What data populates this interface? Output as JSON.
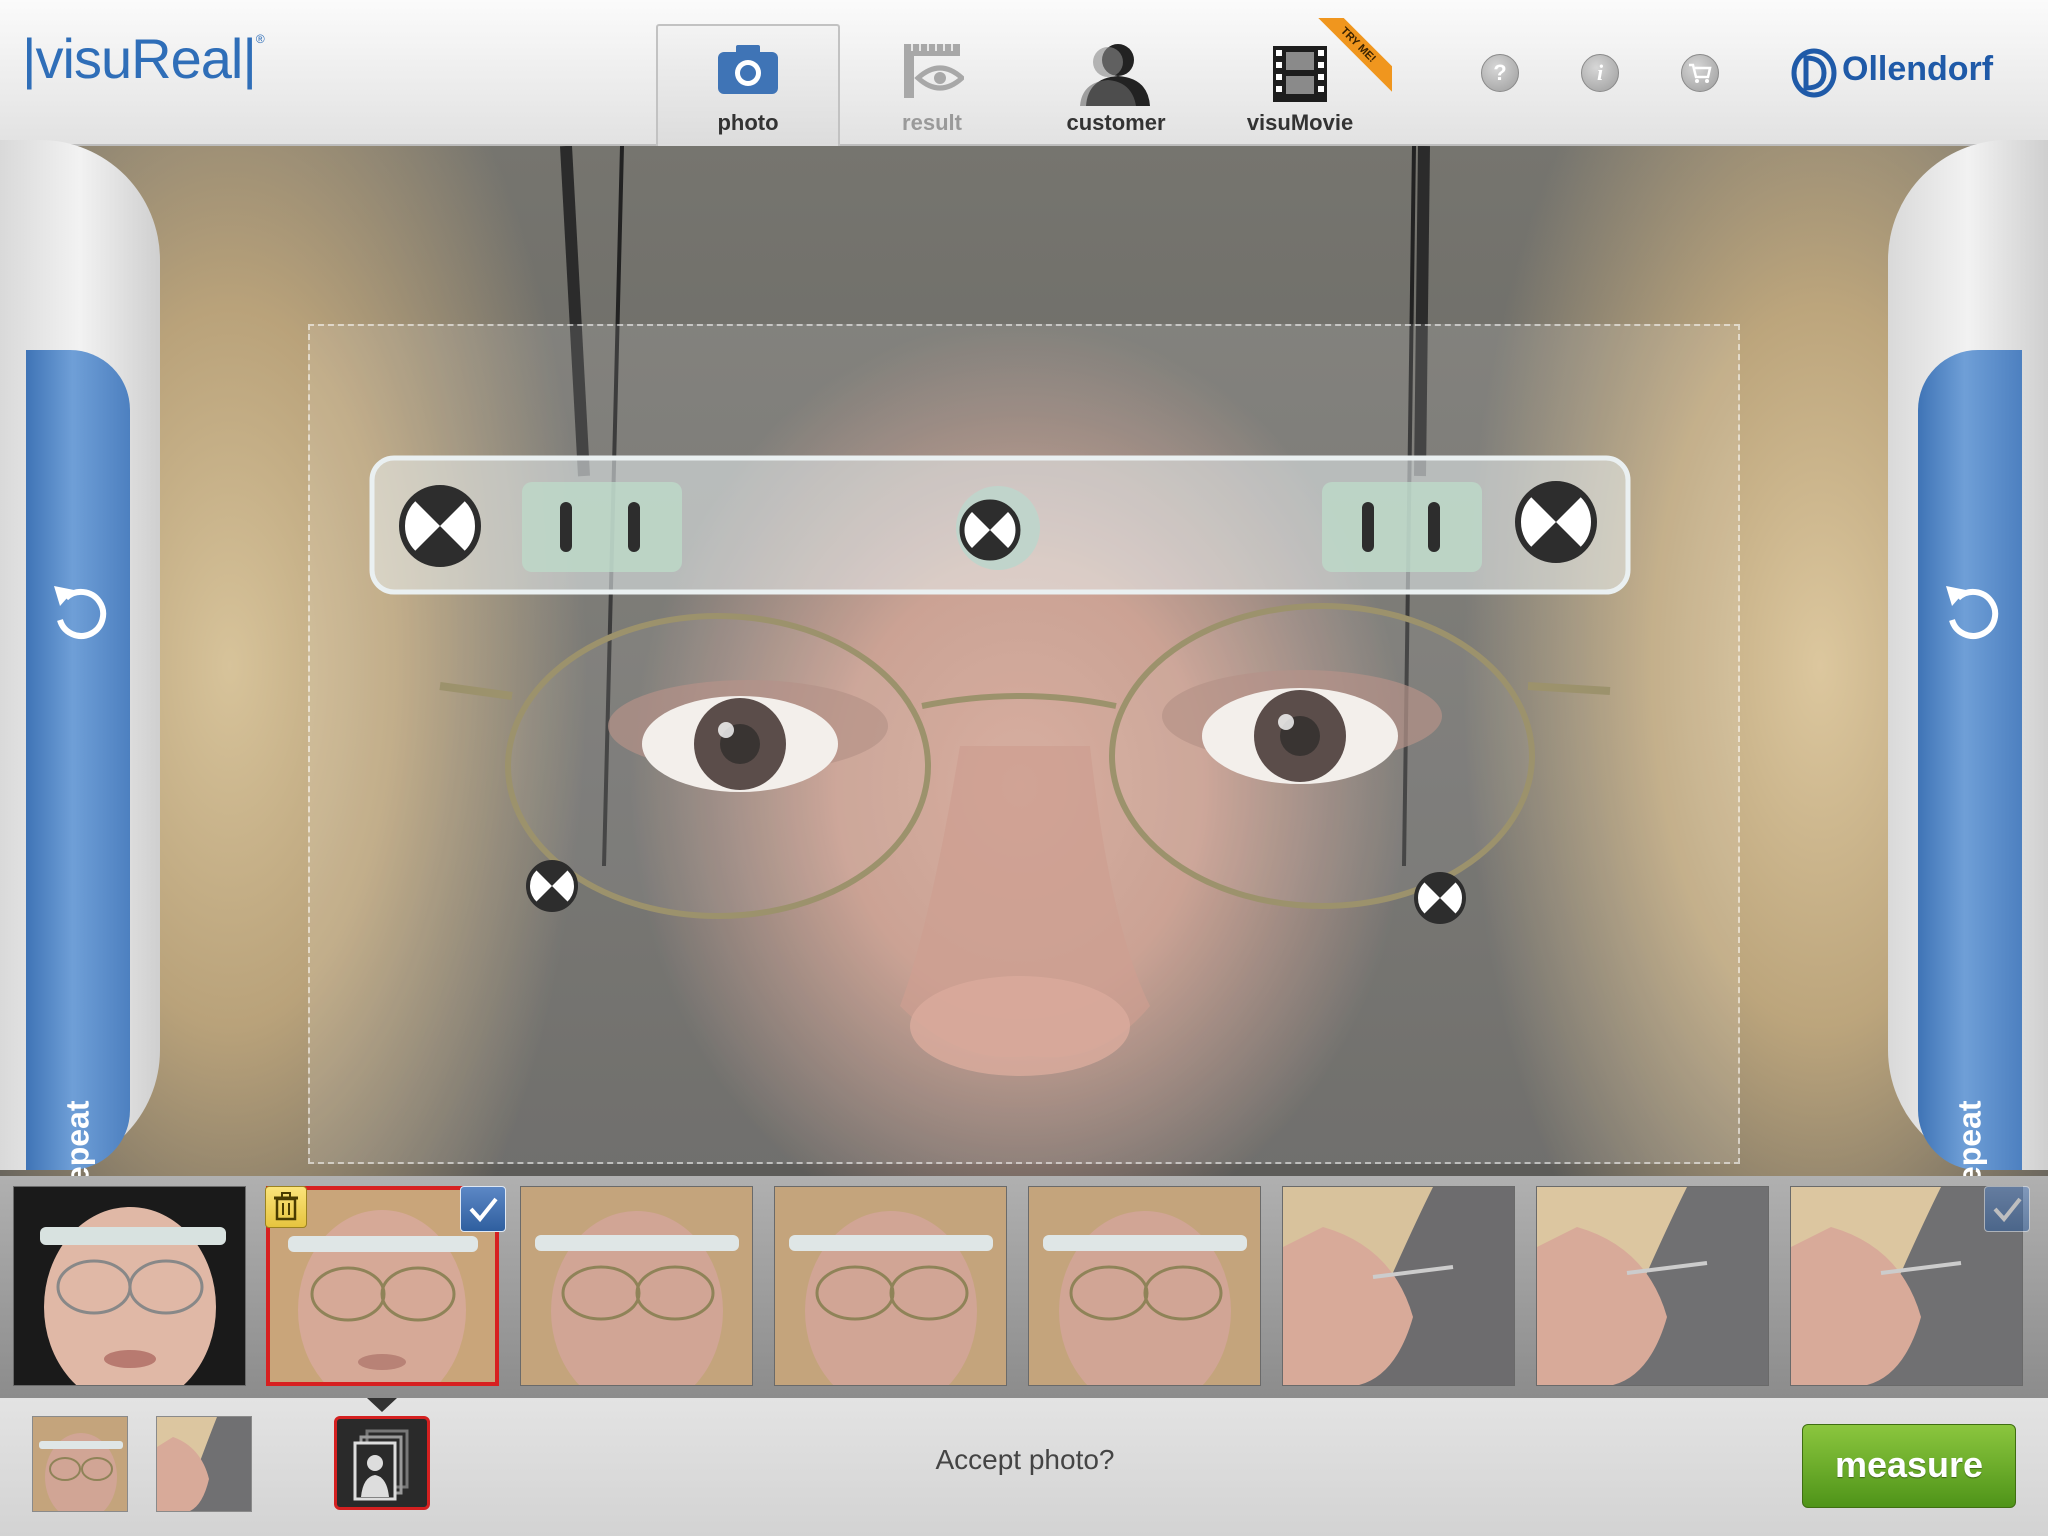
{
  "app": {
    "logo_text": "visuReal",
    "brand": "Ollendorf"
  },
  "tabs": [
    {
      "label": "photo",
      "icon": "camera-icon",
      "state": "active"
    },
    {
      "label": "result",
      "icon": "eye-ruler-icon",
      "state": "disabled"
    },
    {
      "label": "customer",
      "icon": "person-icon",
      "state": "normal"
    },
    {
      "label": "visuMovie",
      "icon": "film-icon",
      "state": "normal",
      "ribbon": "TRY ME!"
    }
  ],
  "header_buttons": [
    {
      "label": "?",
      "icon": "help-icon"
    },
    {
      "label": "i",
      "icon": "info-icon"
    },
    {
      "label": "",
      "icon": "cart-icon"
    }
  ],
  "side": {
    "left_label": "repeat",
    "right_label": "repeat"
  },
  "prompt": "Accept photo?",
  "measure_label": "measure",
  "colors": {
    "accent_blue": "#4f83c3",
    "measure_green": "#6aad2c",
    "selected_red": "#d72020"
  }
}
